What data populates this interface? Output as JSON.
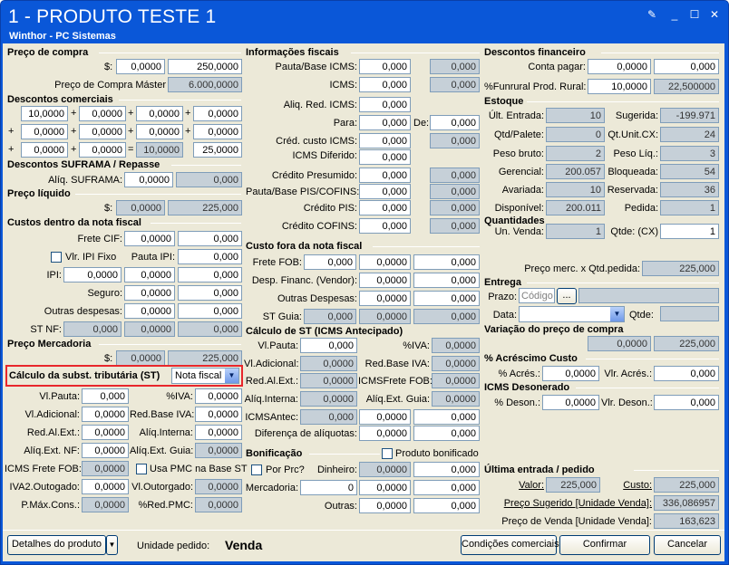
{
  "window": {
    "title": "1 - PRODUTO TESTE 1",
    "subtitle": "Winthor - PC Sistemas"
  },
  "preco_compra": {
    "header": "Preço de compra",
    "currency": "$:",
    "price": "0,0000",
    "value": "250,0000",
    "master_label": "Preço de Compra Máster",
    "master": "6.000,0000"
  },
  "descontos_comerciais": {
    "header": "Descontos comerciais",
    "rows": [
      [
        "10,0000",
        "0,0000",
        "0,0000",
        "0,0000"
      ],
      [
        "0,0000",
        "0,0000",
        "0,0000",
        "0,0000"
      ],
      [
        "0,0000",
        "0,0000",
        "10,0000",
        "25,0000"
      ]
    ]
  },
  "suframa": {
    "header": "Descontos SUFRAMA / Repasse",
    "label": "Alíq. SUFRAMA:",
    "v1": "0,0000",
    "v2": "0,000"
  },
  "preco_liquido": {
    "header": "Preço líquido",
    "currency": "$:",
    "v1": "0,0000",
    "v2": "225,000"
  },
  "custos_nota": {
    "header": "Custos dentro da nota fiscal",
    "frete_label": "Frete CIF:",
    "frete1": "0,0000",
    "frete2": "0,000",
    "ipi_fixo_label": "Vlr. IPI Fixo",
    "pauta_ipi_label": "Pauta IPI:",
    "pauta_ipi": "0,000",
    "ipi_label": "IPI:",
    "ipi1": "0,0000",
    "ipi2": "0,0000",
    "ipi3": "0,000",
    "seguro_label": "Seguro:",
    "seguro1": "0,0000",
    "seguro2": "0,000",
    "outras_label": "Outras despesas:",
    "outras1": "0,0000",
    "outras2": "0,000",
    "stnf_label": "ST NF:",
    "stnf1": "0,000",
    "stnf2": "0,0000",
    "stnf3": "0,000"
  },
  "preco_mercadoria": {
    "header": "Preço Mercadoria",
    "currency": "$:",
    "v1": "0,0000",
    "v2": "225,000"
  },
  "calc_st": {
    "header": "Cálculo da subst. tributária (ST)",
    "select": "Nota fiscal",
    "vl_pauta_label": "Vl.Pauta:",
    "vl_pauta": "0,000",
    "piva_label": "%IVA:",
    "piva": "0,0000",
    "vl_adicional_label": "Vl.Adicional:",
    "vl_adicional": "0,0000",
    "redbase_label": "Red.Base IVA:",
    "redbase": "0,0000",
    "redalext_label": "Red.Al.Ext.:",
    "redalext": "0,0000",
    "aliqint_label": "Alíq.Interna:",
    "aliqint": "0,0000",
    "aliqextnf_label": "Alíq.Ext. NF:",
    "aliqextnf": "0,0000",
    "aliqextguia_label": "Alíq.Ext. Guia:",
    "aliqextguia": "0,0000",
    "icmsfrete_label": "ICMS Frete FOB:",
    "icmsfrete": "0,0000",
    "usapmc_label": "Usa PMC na Base ST",
    "iva2_label": "IVA2.Outogado:",
    "iva2": "0,0000",
    "vloutorgado_label": "Vl.Outorgado:",
    "vloutorgado": "0,0000",
    "pmax_label": "P.Máx.Cons.:",
    "pmax": "0,0000",
    "predpmc_label": "%Red.PMC:",
    "predpmc": "0,0000"
  },
  "info_fiscais": {
    "header": "Informações fiscais",
    "pauta_label": "Pauta/Base ICMS:",
    "pauta1": "0,000",
    "pauta2": "0,000",
    "icms_label": "ICMS:",
    "icms1": "0,000",
    "icms2": "0,000",
    "aliq_red_label": "Aliq. Red. ICMS:",
    "aliq_red": "0,000",
    "para_label": "Para:",
    "para": "0,000",
    "de_label": "De:",
    "de": "0,000",
    "cred_custo_label": "Créd. custo ICMS:",
    "cred_custo1": "0,000",
    "cred_custo2": "0,000",
    "icms_dif_label": "ICMS Diferido:",
    "icms_dif": "0,000",
    "cred_pres_label": "Crédito Presumido:",
    "cred_pres1": "0,000",
    "cred_pres2": "0,000",
    "pauta_pis_label": "Pauta/Base PIS/COFINS:",
    "pauta_pis1": "0,000",
    "pauta_pis2": "0,000",
    "cred_pis_label": "Crédito PIS:",
    "cred_pis1": "0,000",
    "cred_pis2": "0,000",
    "cred_cofins_label": "Crédito COFINS:",
    "cred_cofins1": "0,000",
    "cred_cofins2": "0,000"
  },
  "custo_fora": {
    "header": "Custo fora da nota fiscal",
    "frete_fob_label": "Frete FOB:",
    "frete_fob": [
      "0,000",
      "0,0000",
      "0,000"
    ],
    "desp_fin_label": "Desp. Financ. (Vendor):",
    "desp_fin": [
      "0,0000",
      "0,000"
    ],
    "outras_label": "Outras Despesas:",
    "outras": [
      "0,0000",
      "0,000"
    ],
    "st_guia_label": "ST Guia:",
    "st_guia": [
      "0,000",
      "0,0000",
      "0,000"
    ]
  },
  "calc_st_ant": {
    "header": "Cálculo de ST (ICMS Antecipado)",
    "vl_pauta_label": "Vl.Pauta:",
    "vl_pauta": "0,000",
    "piva_label": "%IVA:",
    "piva": "0,0000",
    "vl_adic_label": "Vl.Adicional:",
    "vl_adic": "0,0000",
    "redbase_label": "Red.Base IVA:",
    "redbase": "0,0000",
    "redalext_label": "Red.Al.Ext.:",
    "redalext": "0,0000",
    "icmsfrete_label": "ICMSFrete FOB:",
    "icmsfrete": "0,0000",
    "aliqint_label": "Alíq.Interna:",
    "aliqint": "0,0000",
    "aliqext_label": "Alíq.Ext. Guia:",
    "aliqext": "0,0000",
    "icmsantec_label": "ICMSAntec:",
    "icmsantec": [
      "0,000",
      "0,0000",
      "0,000"
    ],
    "dif_label": "Diferença de alíquotas:",
    "dif": [
      "0,0000",
      "0,000"
    ]
  },
  "bonificacao": {
    "header": "Bonificação",
    "produto_bonificado": "Produto bonificado",
    "por_prc": "Por Prc?",
    "dinheiro_label": "Dinheiro:",
    "dinheiro": [
      "0,0000",
      "0,000"
    ],
    "mercadoria_label": "Mercadoria:",
    "mercadoria": [
      "0",
      "0,0000",
      "0,000"
    ],
    "outras_label": "Outras:",
    "outras": [
      "0,0000",
      "0,000"
    ]
  },
  "descontos_fin": {
    "header": "Descontos financeiro",
    "conta_pagar_label": "Conta pagar:",
    "conta_pagar": [
      "0,0000",
      "0,000"
    ],
    "funrural_label": "%Funrural Prod. Rural:",
    "funrural": [
      "10,0000",
      "22,500000"
    ]
  },
  "estoque": {
    "header": "Estoque",
    "ult_entrada_label": "Últ. Entrada:",
    "ult_entrada": "10",
    "sugerida_label": "Sugerida:",
    "sugerida": "-199.971",
    "qtd_palete_label": "Qtd/Palete:",
    "qtd_palete": "0",
    "qt_unit_label": "Qt.Unit.CX:",
    "qt_unit": "24",
    "peso_bruto_label": "Peso bruto:",
    "peso_bruto": "2",
    "peso_liq_label": "Peso Líq.:",
    "peso_liq": "3",
    "gerencial_label": "Gerencial:",
    "gerencial": "200.057",
    "bloqueada_label": "Bloqueada:",
    "bloqueada": "54",
    "avariada_label": "Avariada:",
    "avariada": "10",
    "reservada_label": "Reservada:",
    "reservada": "36",
    "disponivel_label": "Disponível:",
    "disponivel": "200.011",
    "pedida_label": "Pedida:",
    "pedida": "1"
  },
  "quantidades": {
    "header": "Quantidades",
    "un_venda_label": "Un. Venda:",
    "un_venda": "1",
    "qtde_cx_label": "Qtde: (CX)",
    "qtde_cx": "1",
    "preco_merc_label": "Preço merc. x Qtd.pedida:",
    "preco_merc": "225,000"
  },
  "entrega": {
    "header": "Entrega",
    "prazo_label": "Prazo:",
    "prazo_placeholder": "Código",
    "browse": "...",
    "data_label": "Data:",
    "qtde_label": "Qtde:"
  },
  "variacao": {
    "header": "Variação do preço de compra",
    "v1": "0,0000",
    "v2": "225,000"
  },
  "acrescimo": {
    "header": "% Acréscimo Custo",
    "pacres_label": "% Acrés.:",
    "pacres": "0,0000",
    "vlracres_label": "Vlr. Acrés.:",
    "vlracres": "0,000"
  },
  "icms_desonerado": {
    "header": "ICMS Desonerado",
    "pdeson_label": "% Deson.:",
    "pdeson": "0,0000",
    "vlrdeson_label": "Vlr. Deson.:",
    "vlrdeson": "0,000"
  },
  "ultima_entrada": {
    "header": "Última entrada / pedido",
    "valor_label": "Valor:",
    "valor": "225,000",
    "custo_label": "Custo:",
    "custo": "225,000",
    "preco_sug_label": "Preço Sugerido [Unidade Venda]:",
    "preco_sug": "336,086957",
    "preco_venda_label": "Preço de Venda [Unidade Venda]:",
    "preco_venda": "163,623"
  },
  "footer": {
    "detalhes": "Detalhes do produto",
    "unidade_label": "Unidade pedido:",
    "unidade": "Venda",
    "condicoes": "Condições comerciais",
    "confirmar": "Confirmar",
    "cancelar": "Cancelar"
  },
  "colors": {
    "titlebar": "#0a57d8",
    "panel": "#ece9d8",
    "readonly": "#c6d0d8",
    "highlight": "#e8262b"
  }
}
